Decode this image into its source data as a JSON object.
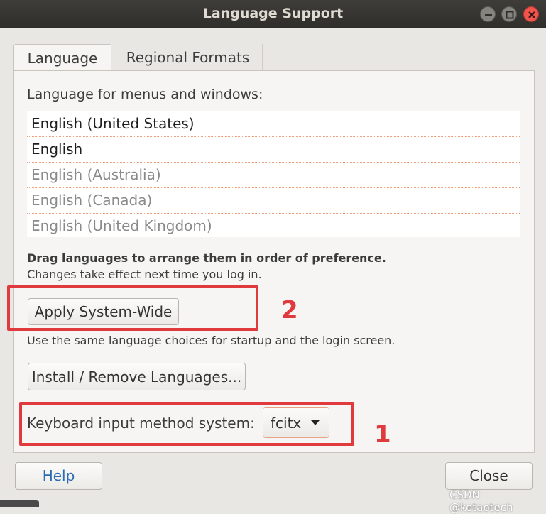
{
  "window": {
    "title": "Language Support",
    "buttons": {
      "minimize": "minimize-icon",
      "maximize": "maximize-icon",
      "close": "close-icon"
    }
  },
  "tabs": [
    {
      "label": "Language",
      "active": true
    },
    {
      "label": "Regional Formats",
      "active": false
    }
  ],
  "language_section": {
    "label": "Language for menus and windows:",
    "languages": [
      {
        "name": "English (United States)",
        "enabled": true
      },
      {
        "name": "English",
        "enabled": true
      },
      {
        "name": "English (Australia)",
        "enabled": false
      },
      {
        "name": "English (Canada)",
        "enabled": false
      },
      {
        "name": "English (United Kingdom)",
        "enabled": false
      }
    ],
    "hint_bold": "Drag languages to arrange them in order of preference.",
    "hint": "Changes take effect next time you log in.",
    "apply_button": "Apply System-Wide",
    "apply_description": "Use the same language choices for startup and the login screen.",
    "install_button": "Install / Remove Languages..."
  },
  "keyboard_input": {
    "label": "Keyboard input method system:",
    "selected": "fcitx"
  },
  "footer": {
    "help_button": "Help",
    "close_button": "Close"
  },
  "annotations": {
    "box_1_number": "1",
    "box_2_number": "2",
    "color": "#e03a3f"
  },
  "watermark": "CSDN @ketaotech"
}
